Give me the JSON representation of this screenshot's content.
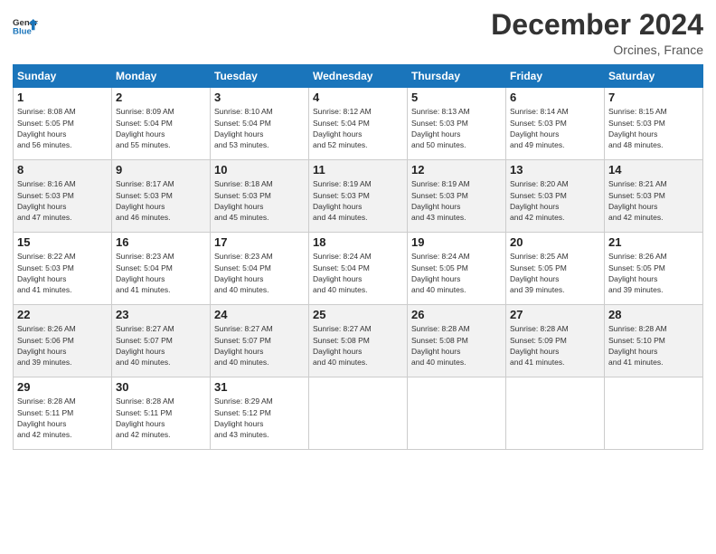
{
  "header": {
    "logo_general": "General",
    "logo_blue": "Blue",
    "title": "December 2024",
    "location": "Orcines, France"
  },
  "days_of_week": [
    "Sunday",
    "Monday",
    "Tuesday",
    "Wednesday",
    "Thursday",
    "Friday",
    "Saturday"
  ],
  "weeks": [
    [
      {
        "day": "1",
        "sunrise": "8:08 AM",
        "sunset": "5:05 PM",
        "daylight": "8 hours and 56 minutes."
      },
      {
        "day": "2",
        "sunrise": "8:09 AM",
        "sunset": "5:04 PM",
        "daylight": "8 hours and 55 minutes."
      },
      {
        "day": "3",
        "sunrise": "8:10 AM",
        "sunset": "5:04 PM",
        "daylight": "8 hours and 53 minutes."
      },
      {
        "day": "4",
        "sunrise": "8:12 AM",
        "sunset": "5:04 PM",
        "daylight": "8 hours and 52 minutes."
      },
      {
        "day": "5",
        "sunrise": "8:13 AM",
        "sunset": "5:03 PM",
        "daylight": "8 hours and 50 minutes."
      },
      {
        "day": "6",
        "sunrise": "8:14 AM",
        "sunset": "5:03 PM",
        "daylight": "8 hours and 49 minutes."
      },
      {
        "day": "7",
        "sunrise": "8:15 AM",
        "sunset": "5:03 PM",
        "daylight": "8 hours and 48 minutes."
      }
    ],
    [
      {
        "day": "8",
        "sunrise": "8:16 AM",
        "sunset": "5:03 PM",
        "daylight": "8 hours and 47 minutes."
      },
      {
        "day": "9",
        "sunrise": "8:17 AM",
        "sunset": "5:03 PM",
        "daylight": "8 hours and 46 minutes."
      },
      {
        "day": "10",
        "sunrise": "8:18 AM",
        "sunset": "5:03 PM",
        "daylight": "8 hours and 45 minutes."
      },
      {
        "day": "11",
        "sunrise": "8:19 AM",
        "sunset": "5:03 PM",
        "daylight": "8 hours and 44 minutes."
      },
      {
        "day": "12",
        "sunrise": "8:19 AM",
        "sunset": "5:03 PM",
        "daylight": "8 hours and 43 minutes."
      },
      {
        "day": "13",
        "sunrise": "8:20 AM",
        "sunset": "5:03 PM",
        "daylight": "8 hours and 42 minutes."
      },
      {
        "day": "14",
        "sunrise": "8:21 AM",
        "sunset": "5:03 PM",
        "daylight": "8 hours and 42 minutes."
      }
    ],
    [
      {
        "day": "15",
        "sunrise": "8:22 AM",
        "sunset": "5:03 PM",
        "daylight": "8 hours and 41 minutes."
      },
      {
        "day": "16",
        "sunrise": "8:23 AM",
        "sunset": "5:04 PM",
        "daylight": "8 hours and 41 minutes."
      },
      {
        "day": "17",
        "sunrise": "8:23 AM",
        "sunset": "5:04 PM",
        "daylight": "8 hours and 40 minutes."
      },
      {
        "day": "18",
        "sunrise": "8:24 AM",
        "sunset": "5:04 PM",
        "daylight": "8 hours and 40 minutes."
      },
      {
        "day": "19",
        "sunrise": "8:24 AM",
        "sunset": "5:05 PM",
        "daylight": "8 hours and 40 minutes."
      },
      {
        "day": "20",
        "sunrise": "8:25 AM",
        "sunset": "5:05 PM",
        "daylight": "8 hours and 39 minutes."
      },
      {
        "day": "21",
        "sunrise": "8:26 AM",
        "sunset": "5:05 PM",
        "daylight": "8 hours and 39 minutes."
      }
    ],
    [
      {
        "day": "22",
        "sunrise": "8:26 AM",
        "sunset": "5:06 PM",
        "daylight": "8 hours and 39 minutes."
      },
      {
        "day": "23",
        "sunrise": "8:27 AM",
        "sunset": "5:07 PM",
        "daylight": "8 hours and 40 minutes."
      },
      {
        "day": "24",
        "sunrise": "8:27 AM",
        "sunset": "5:07 PM",
        "daylight": "8 hours and 40 minutes."
      },
      {
        "day": "25",
        "sunrise": "8:27 AM",
        "sunset": "5:08 PM",
        "daylight": "8 hours and 40 minutes."
      },
      {
        "day": "26",
        "sunrise": "8:28 AM",
        "sunset": "5:08 PM",
        "daylight": "8 hours and 40 minutes."
      },
      {
        "day": "27",
        "sunrise": "8:28 AM",
        "sunset": "5:09 PM",
        "daylight": "8 hours and 41 minutes."
      },
      {
        "day": "28",
        "sunrise": "8:28 AM",
        "sunset": "5:10 PM",
        "daylight": "8 hours and 41 minutes."
      }
    ],
    [
      {
        "day": "29",
        "sunrise": "8:28 AM",
        "sunset": "5:11 PM",
        "daylight": "8 hours and 42 minutes."
      },
      {
        "day": "30",
        "sunrise": "8:28 AM",
        "sunset": "5:11 PM",
        "daylight": "8 hours and 42 minutes."
      },
      {
        "day": "31",
        "sunrise": "8:29 AM",
        "sunset": "5:12 PM",
        "daylight": "8 hours and 43 minutes."
      },
      null,
      null,
      null,
      null
    ]
  ]
}
